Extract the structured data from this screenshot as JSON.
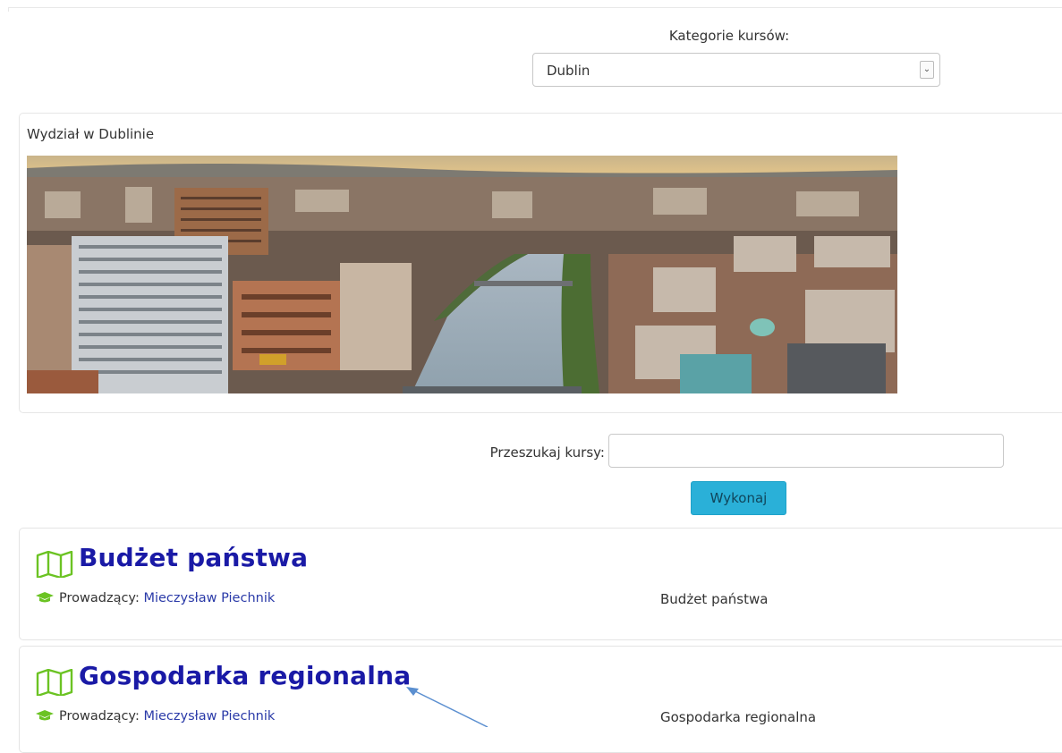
{
  "category": {
    "label": "Kategorie kursów:",
    "selected": "Dublin"
  },
  "department": {
    "title": "Wydział w Dublinie"
  },
  "search": {
    "label": "Przeszukaj kursy:",
    "value": "",
    "button": "Wykonaj"
  },
  "courses": [
    {
      "title": "Budżet państwa",
      "teacher_label": "Prowadzący:",
      "teacher_name": "Mieczysław Piechnik",
      "summary": "Budżet państwa"
    },
    {
      "title": "Gospodarka regionalna",
      "teacher_label": "Prowadzący:",
      "teacher_name": "Mieczysław Piechnik",
      "summary": "Gospodarka regionalna"
    }
  ],
  "colors": {
    "course_title": "#1a1aa6",
    "icon_green": "#6bc323",
    "button": "#2ab0d8",
    "link": "#2a3aa8"
  },
  "icons": {
    "course": "map-icon",
    "teacher": "graduation-cap-icon",
    "select": "chevron-down-icon"
  }
}
